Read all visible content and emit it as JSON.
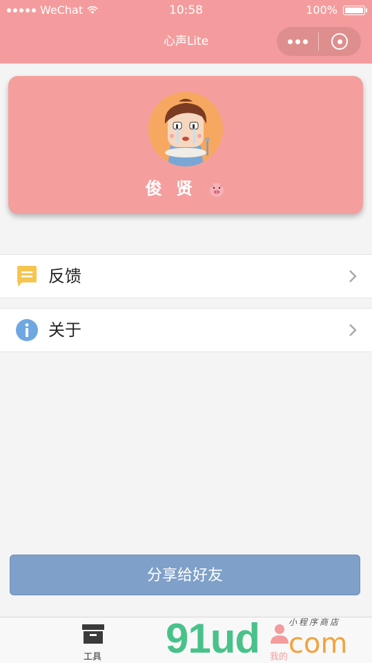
{
  "status_bar": {
    "carrier": "WeChat",
    "time": "10:58",
    "battery": "100%"
  },
  "nav": {
    "title": "心声Lite"
  },
  "profile": {
    "name": "俊 贤"
  },
  "menu": {
    "items": [
      {
        "label": "反馈",
        "icon": "feedback-icon",
        "icon_color": "#f6c550"
      },
      {
        "label": "关于",
        "icon": "info-icon",
        "icon_color": "#6fa8e0"
      }
    ]
  },
  "share_button": {
    "label": "分享给好友",
    "color": "#7ea0c9"
  },
  "tabbar": {
    "tabs": [
      {
        "label": "工具",
        "icon": "archive-box-icon"
      },
      {
        "label": "我的",
        "icon": "user-icon"
      }
    ]
  },
  "watermark": {
    "brand": "91ud",
    "suffix": "com",
    "sub": "小程序商店"
  },
  "colors": {
    "brand_pink": "#f49c9d",
    "background": "#f4f4f4"
  }
}
